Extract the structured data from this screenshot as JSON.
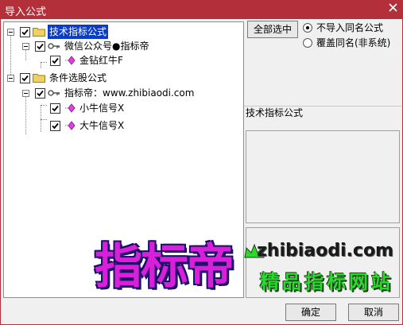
{
  "window": {
    "title": "导入公式"
  },
  "tree": [
    {
      "label": "技术指标公式",
      "checked": true,
      "selected": true,
      "icon": "folder-icon"
    },
    {
      "label": "微信公众号●指标帝",
      "checked": true,
      "icon": "key-icon"
    },
    {
      "label": "金钻红牛F",
      "checked": true,
      "icon": "diamond-icon",
      "color": "#e040e0"
    },
    {
      "label": "条件选股公式",
      "checked": true,
      "icon": "folder-icon"
    },
    {
      "label": "指标帝：www.zhibiaodi.com",
      "checked": true,
      "icon": "key-icon"
    },
    {
      "label": "小牛信号X",
      "checked": true,
      "icon": "diamond-icon",
      "color": "#e040e0"
    },
    {
      "label": "大牛信号X",
      "checked": true,
      "icon": "diamond-icon",
      "color": "#e040e0"
    }
  ],
  "options": {
    "select_all": "全部选中",
    "radio_no_import": "不导入同名公式",
    "radio_overwrite": "覆盖同名(非系统)",
    "selected_radio": "radio_no_import"
  },
  "info_label": "技术指标公式",
  "watermark": {
    "big": "指标帝",
    "domain": "zhibiaodi.com",
    "slogan": "精品指标网站"
  },
  "footer": {
    "ok": "确定",
    "cancel": "取消"
  },
  "colors": {
    "titlebar": "#b3303a",
    "selection": "#0a3cc8",
    "diamond": "#e040e0",
    "folder": "#f0d060"
  }
}
